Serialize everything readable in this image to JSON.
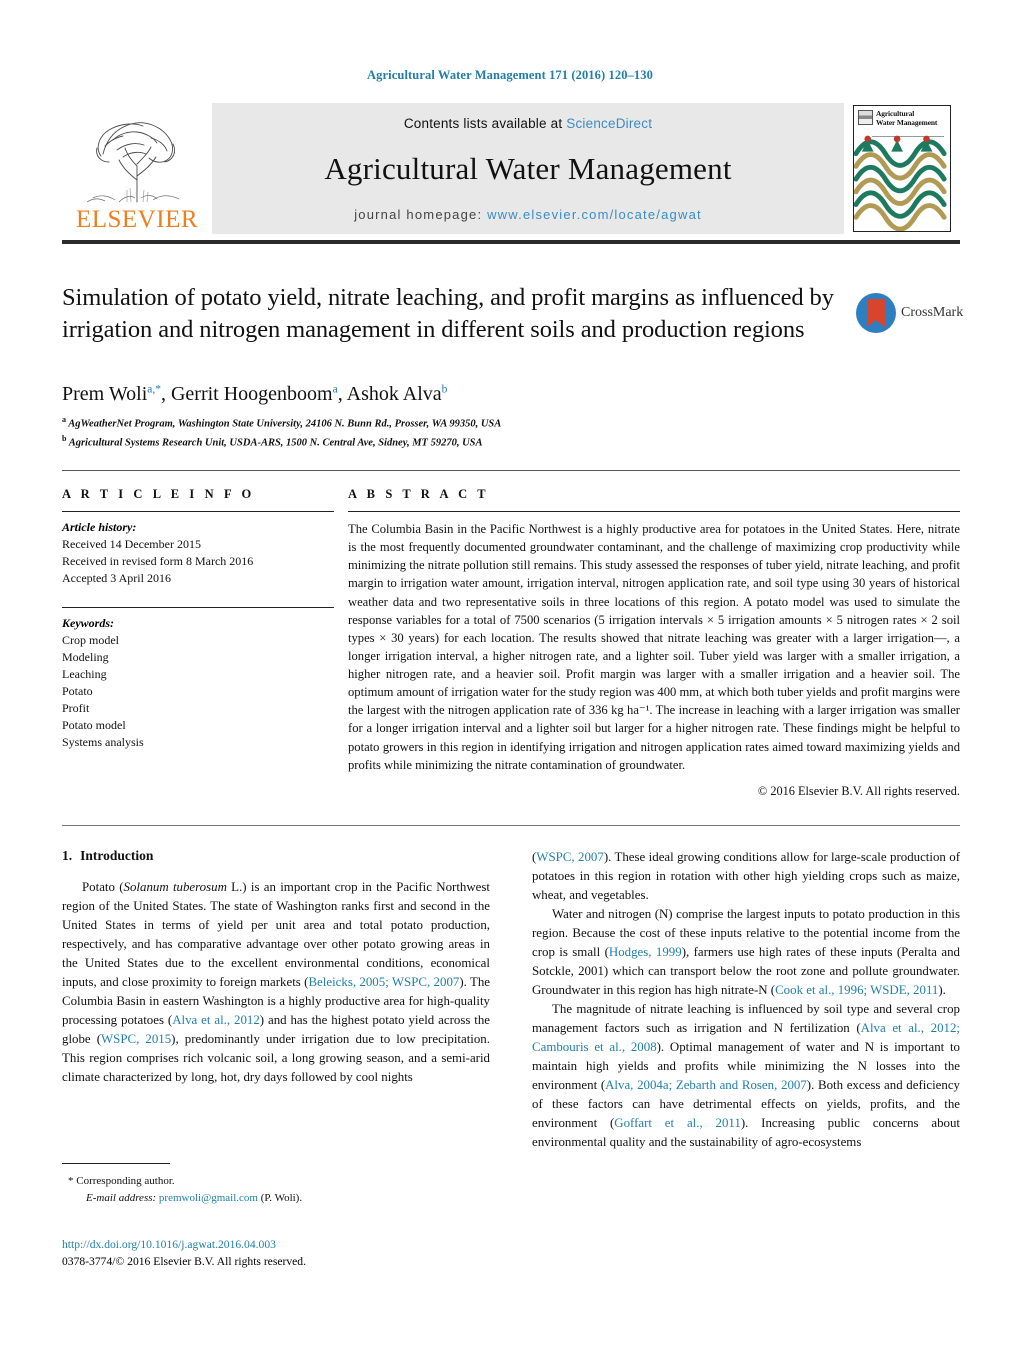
{
  "running_head": "Agricultural Water Management 171 (2016) 120–130",
  "banner": {
    "publisher_name": "ELSEVIER",
    "contents_prefix": "Contents lists available at ",
    "contents_link": "ScienceDirect",
    "journal_title": "Agricultural Water Management",
    "homepage_prefix": "journal homepage: ",
    "homepage_url": "www.elsevier.com/locate/agwat",
    "cover_title_line1": "Agricultural",
    "cover_title_line2": "Water Management"
  },
  "title": "Simulation of potato yield, nitrate leaching, and profit margins as influenced by irrigation and nitrogen management in different soils and production regions",
  "crossmark_label": "CrossMark",
  "authors": {
    "a1_name": "Prem Woli",
    "a1_sup": "a,*",
    "sep1": ", ",
    "a2_name": "Gerrit Hoogenboom",
    "a2_sup": "a",
    "sep2": ", ",
    "a3_name": "Ashok Alva",
    "a3_sup": "b"
  },
  "affiliations": [
    {
      "marker": "a",
      "text": "AgWeatherNet Program, Washington State University, 24106 N. Bunn Rd., Prosser, WA 99350, USA"
    },
    {
      "marker": "b",
      "text": "Agricultural Systems Research Unit, USDA-ARS, 1500 N. Central Ave, Sidney, MT 59270, USA"
    }
  ],
  "article_info": {
    "heading": "A R T I C L E   I N F O",
    "history_label": "Article history:",
    "history": [
      "Received 14 December 2015",
      "Received in revised form 8 March 2016",
      "Accepted 3 April 2016"
    ],
    "keywords_label": "Keywords:",
    "keywords": [
      "Crop model",
      "Modeling",
      "Leaching",
      "Potato",
      "Profit",
      "Potato model",
      "Systems analysis"
    ]
  },
  "abstract": {
    "heading": "A B S T R A C T",
    "text": "The Columbia Basin in the Pacific Northwest is a highly productive area for potatoes in the United States. Here, nitrate is the most frequently documented groundwater contaminant, and the challenge of maximizing crop productivity while minimizing the nitrate pollution still remains. This study assessed the responses of tuber yield, nitrate leaching, and profit margin to irrigation water amount, irrigation interval, nitrogen application rate, and soil type using 30 years of historical weather data and two representative soils in three locations of this region. A potato model was used to simulate the response variables for a total of 7500 scenarios (5 irrigation intervals × 5 irrigation amounts × 5 nitrogen rates × 2 soil types × 30 years) for each location. The results showed that nitrate leaching was greater with a larger irrigation—, a longer irrigation interval, a higher nitrogen rate, and a lighter soil. Tuber yield was larger with a smaller irrigation, a higher nitrogen rate, and a heavier soil. Profit margin was larger with a smaller irrigation and a heavier soil. The optimum amount of irrigation water for the study region was 400 mm, at which both tuber yields and profit margins were the largest with the nitrogen application rate of 336 kg ha⁻¹. The increase in leaching with a larger irrigation was smaller for a longer irrigation interval and a lighter soil but larger for a higher nitrogen rate. These findings might be helpful to potato growers in this region in identifying irrigation and nitrogen application rates aimed toward maximizing yields and profits while minimizing the nitrate contamination of groundwater.",
    "copyright": "© 2016 Elsevier B.V. All rights reserved."
  },
  "body": {
    "section_number": "1.",
    "section_title": "Introduction",
    "left_paragraphs": [
      "Potato (Solanum tuberosum L.) is an important crop in the Pacific Northwest region of the United States. The state of Washington ranks first and second in the United States in terms of yield per unit area and total potato production, respectively, and has comparative advantage over other potato growing areas in the United States due to the excellent environmental conditions, economical inputs, and close proximity to foreign markets (Beleicks, 2005; WSPC, 2007). The Columbia Basin in eastern Washington is a highly productive area for high-quality processing potatoes (Alva et al., 2012) and has the highest potato yield across the globe (WSPC, 2015), predominantly under irrigation due to low precipitation. This region comprises rich volcanic soil, a long growing season, and a semi-arid climate characterized by long, hot, dry days followed by cool nights"
    ],
    "right_paragraphs": [
      "(WSPC, 2007). These ideal growing conditions allow for large-scale production of potatoes in this region in rotation with other high yielding crops such as maize, wheat, and vegetables.",
      "Water and nitrogen (N) comprise the largest inputs to potato production in this region. Because the cost of these inputs relative to the potential income from the crop is small (Hodges, 1999), farmers use high rates of these inputs (Peralta and Sotckle, 2001) which can transport below the root zone and pollute groundwater. Groundwater in this region has high nitrate-N (Cook et al., 1996; WSDE, 2011).",
      "The magnitude of nitrate leaching is influenced by soil type and several crop management factors such as irrigation and N fertilization (Alva et al., 2012; Cambouris et al., 2008). Optimal management of water and N is important to maintain high yields and profits while minimizing the N losses into the environment (Alva, 2004a; Zebarth and Rosen, 2007). Both excess and deficiency of these factors can have detrimental effects on yields, profits, and the environment (Goffart et al., 2011). Increasing public concerns about environmental quality and the sustainability of agro-ecosystems"
    ]
  },
  "footnote": {
    "asterisk": "*",
    "corresponding": "Corresponding author.",
    "email_label": "E-mail address:",
    "email": "premwoli@gmail.com",
    "email_suffix": "(P. Woli)."
  },
  "doi": {
    "url": "http://dx.doi.org/10.1016/j.agwat.2016.04.003",
    "issn_line": "0378-3774/© 2016 Elsevier B.V. All rights reserved."
  },
  "colors": {
    "link_blue": "#1f7fa8",
    "sciencedirect_blue": "#3a8cc4",
    "elsevier_orange": "#f07d20",
    "banner_grey": "#e8e8e8"
  }
}
